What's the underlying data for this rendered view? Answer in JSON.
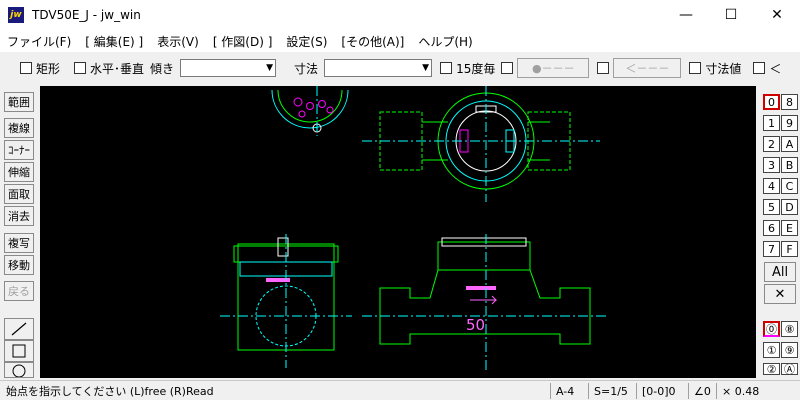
{
  "window": {
    "title": "TDV50E_J - jw_win",
    "icon": "jw",
    "minimize_glyph": "—",
    "maximize_glyph": "☐",
    "close_glyph": "✕"
  },
  "menu": [
    "ファイル(F)",
    "[ 編集(E) ]",
    "表示(V)",
    "[ 作図(D) ]",
    "設定(S)",
    "[その他(A)]",
    "ヘルプ(H)"
  ],
  "toolbar": {
    "rect": "矩形",
    "horiz_vert": "水平･垂直",
    "tilt": "傾き",
    "tilt_value": "",
    "dimension": "寸法",
    "dimension_value": "",
    "deg15": "15度毎",
    "circle_btn": "●－－－",
    "arrow_btn": "＜－－－",
    "dim_value": "寸法値",
    "lt": "＜"
  },
  "left_tools": [
    "範囲",
    "複線",
    "ｺｰﾅｰ",
    "伸縮",
    "面取",
    "消去",
    "複写",
    "移動",
    "戻る"
  ],
  "layers": {
    "col1": [
      "0",
      "1",
      "2",
      "3",
      "4",
      "5",
      "6",
      "7"
    ],
    "col2": [
      "8",
      "9",
      "A",
      "B",
      "C",
      "D",
      "E",
      "F"
    ],
    "active": "0",
    "all_label": "All",
    "cross_label": "✕",
    "groups": [
      "⓪",
      "①",
      "②"
    ],
    "groups2": [
      "⑧",
      "⑨",
      "Ⓐ"
    ]
  },
  "drawing": {
    "label": "50"
  },
  "status": {
    "message": "始点を指示してください (L)free (R)Read",
    "paper": "A-4",
    "scale": "S=1/5",
    "layer": "[0-0]0",
    "angle": "∠0",
    "zoom": "× 0.48"
  }
}
